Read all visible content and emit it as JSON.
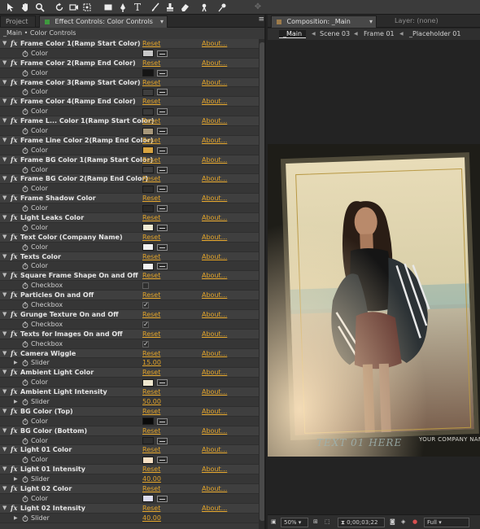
{
  "left_panel": {
    "tab_project": "Project",
    "tab_effect_controls": "Effect Controls: Color Controls",
    "breadcrumb": "_Main • Color Controls"
  },
  "right_panel": {
    "tab_composition": "Composition: _Main",
    "tab_layer": "Layer: (none)",
    "crumbs": [
      "_Main",
      "Scene 03",
      "Frame 01",
      "_Placeholder 01"
    ]
  },
  "effects": [
    {
      "name": "Frame Color 1(Ramp Start Color)",
      "param": "Color",
      "type": "color",
      "value": "#c8c8c8"
    },
    {
      "name": "Frame Color 2(Ramp End Color)",
      "param": "Color",
      "type": "color",
      "value": "#151515"
    },
    {
      "name": "Frame Color 3(Ramp Start Color)",
      "param": "Color",
      "type": "color",
      "value": "#3e3e3e"
    },
    {
      "name": "Frame Color 4(Ramp End Color)",
      "param": "Color",
      "type": "color",
      "value": "#3a3a3a"
    },
    {
      "name": "Frame L... Color 1(Ramp Start Color)",
      "param": "Color",
      "type": "color",
      "value": "#a8987a"
    },
    {
      "name": "Frame Line Color 2(Ramp End Color)",
      "param": "Color",
      "type": "color",
      "value": "#d8a440"
    },
    {
      "name": "Frame BG Color 1(Ramp Start Color)",
      "param": "Color",
      "type": "color",
      "value": "#3e3e3e"
    },
    {
      "name": "Frame BG Color 2(Ramp End Color)",
      "param": "Color",
      "type": "color",
      "value": "#2e2e2e"
    },
    {
      "name": "Frame Shadow Color",
      "param": "Color",
      "type": "color",
      "value": "#2a2a2a"
    },
    {
      "name": "Light Leaks Color",
      "param": "Color",
      "type": "color",
      "value": "#efe9d2"
    },
    {
      "name": "Text Color (Company Name)",
      "param": "Color",
      "type": "color",
      "value": "#f0f0f0"
    },
    {
      "name": "Texts Color",
      "param": "Color",
      "type": "color",
      "value": "#f2f2f2"
    },
    {
      "name": "Square Frame Shape On and Off",
      "param": "Checkbox",
      "type": "checkbox",
      "value": ""
    },
    {
      "name": "Particles On and Off",
      "param": "Checkbox",
      "type": "checkbox",
      "value": "✓"
    },
    {
      "name": "Grunge Texture On and Off",
      "param": "Checkbox",
      "type": "checkbox",
      "value": "✓"
    },
    {
      "name": "Texts for Images On and Off",
      "param": "Checkbox",
      "type": "checkbox",
      "value": "✓"
    },
    {
      "name": "Camera Wiggle",
      "param": "Slider",
      "type": "slider",
      "value": "15.00"
    },
    {
      "name": "Ambient Light Color",
      "param": "Color",
      "type": "color",
      "value": "#efe7cf"
    },
    {
      "name": "Ambient Light Intensity",
      "param": "Slider",
      "type": "slider",
      "value": "50.00"
    },
    {
      "name": "BG Color (Top)",
      "param": "Color",
      "type": "color",
      "value": "#0a0a0a"
    },
    {
      "name": "BG Color (Bottom)",
      "param": "Color",
      "type": "color",
      "value": "#2e2e2e"
    },
    {
      "name": "Light 01 Color",
      "param": "Color",
      "type": "color",
      "value": "#f6e0c4"
    },
    {
      "name": "Light 01 Intensity",
      "param": "Slider",
      "type": "slider",
      "value": "40.00"
    },
    {
      "name": "Light 02 Color",
      "param": "Color",
      "type": "color",
      "value": "#dcdcf0"
    },
    {
      "name": "Light 02 Intensity",
      "param": "Slider",
      "type": "slider",
      "value": "40.00"
    }
  ],
  "labels": {
    "reset": "Reset",
    "about": "About..."
  },
  "viewer": {
    "frame_text": "TEXT 01 HERE",
    "company_text": "YOUR COMPANY NAM"
  },
  "statusbar": {
    "zoom": "50%",
    "timecode": "0;00;03;22",
    "resolution": "Full"
  }
}
